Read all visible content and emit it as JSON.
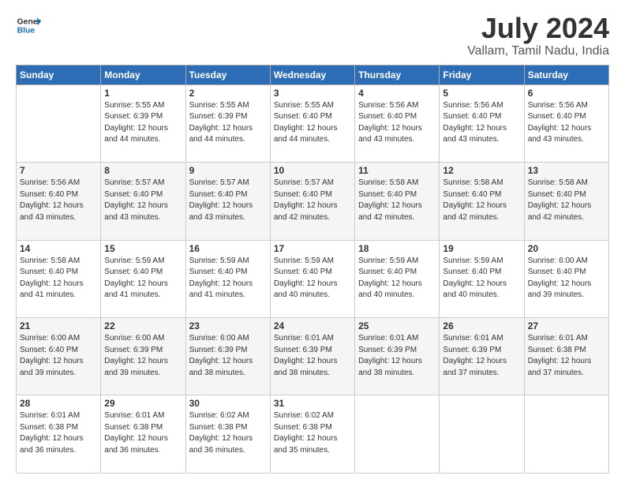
{
  "logo": {
    "line1": "General",
    "line2": "Blue"
  },
  "title": "July 2024",
  "subtitle": "Vallam, Tamil Nadu, India",
  "header_days": [
    "Sunday",
    "Monday",
    "Tuesday",
    "Wednesday",
    "Thursday",
    "Friday",
    "Saturday"
  ],
  "weeks": [
    [
      {
        "day": "",
        "sunrise": "",
        "sunset": "",
        "daylight": ""
      },
      {
        "day": "1",
        "sunrise": "Sunrise: 5:55 AM",
        "sunset": "Sunset: 6:39 PM",
        "daylight": "Daylight: 12 hours and 44 minutes."
      },
      {
        "day": "2",
        "sunrise": "Sunrise: 5:55 AM",
        "sunset": "Sunset: 6:39 PM",
        "daylight": "Daylight: 12 hours and 44 minutes."
      },
      {
        "day": "3",
        "sunrise": "Sunrise: 5:55 AM",
        "sunset": "Sunset: 6:40 PM",
        "daylight": "Daylight: 12 hours and 44 minutes."
      },
      {
        "day": "4",
        "sunrise": "Sunrise: 5:56 AM",
        "sunset": "Sunset: 6:40 PM",
        "daylight": "Daylight: 12 hours and 43 minutes."
      },
      {
        "day": "5",
        "sunrise": "Sunrise: 5:56 AM",
        "sunset": "Sunset: 6:40 PM",
        "daylight": "Daylight: 12 hours and 43 minutes."
      },
      {
        "day": "6",
        "sunrise": "Sunrise: 5:56 AM",
        "sunset": "Sunset: 6:40 PM",
        "daylight": "Daylight: 12 hours and 43 minutes."
      }
    ],
    [
      {
        "day": "7",
        "sunrise": "Sunrise: 5:56 AM",
        "sunset": "Sunset: 6:40 PM",
        "daylight": "Daylight: 12 hours and 43 minutes."
      },
      {
        "day": "8",
        "sunrise": "Sunrise: 5:57 AM",
        "sunset": "Sunset: 6:40 PM",
        "daylight": "Daylight: 12 hours and 43 minutes."
      },
      {
        "day": "9",
        "sunrise": "Sunrise: 5:57 AM",
        "sunset": "Sunset: 6:40 PM",
        "daylight": "Daylight: 12 hours and 43 minutes."
      },
      {
        "day": "10",
        "sunrise": "Sunrise: 5:57 AM",
        "sunset": "Sunset: 6:40 PM",
        "daylight": "Daylight: 12 hours and 42 minutes."
      },
      {
        "day": "11",
        "sunrise": "Sunrise: 5:58 AM",
        "sunset": "Sunset: 6:40 PM",
        "daylight": "Daylight: 12 hours and 42 minutes."
      },
      {
        "day": "12",
        "sunrise": "Sunrise: 5:58 AM",
        "sunset": "Sunset: 6:40 PM",
        "daylight": "Daylight: 12 hours and 42 minutes."
      },
      {
        "day": "13",
        "sunrise": "Sunrise: 5:58 AM",
        "sunset": "Sunset: 6:40 PM",
        "daylight": "Daylight: 12 hours and 42 minutes."
      }
    ],
    [
      {
        "day": "14",
        "sunrise": "Sunrise: 5:58 AM",
        "sunset": "Sunset: 6:40 PM",
        "daylight": "Daylight: 12 hours and 41 minutes."
      },
      {
        "day": "15",
        "sunrise": "Sunrise: 5:59 AM",
        "sunset": "Sunset: 6:40 PM",
        "daylight": "Daylight: 12 hours and 41 minutes."
      },
      {
        "day": "16",
        "sunrise": "Sunrise: 5:59 AM",
        "sunset": "Sunset: 6:40 PM",
        "daylight": "Daylight: 12 hours and 41 minutes."
      },
      {
        "day": "17",
        "sunrise": "Sunrise: 5:59 AM",
        "sunset": "Sunset: 6:40 PM",
        "daylight": "Daylight: 12 hours and 40 minutes."
      },
      {
        "day": "18",
        "sunrise": "Sunrise: 5:59 AM",
        "sunset": "Sunset: 6:40 PM",
        "daylight": "Daylight: 12 hours and 40 minutes."
      },
      {
        "day": "19",
        "sunrise": "Sunrise: 5:59 AM",
        "sunset": "Sunset: 6:40 PM",
        "daylight": "Daylight: 12 hours and 40 minutes."
      },
      {
        "day": "20",
        "sunrise": "Sunrise: 6:00 AM",
        "sunset": "Sunset: 6:40 PM",
        "daylight": "Daylight: 12 hours and 39 minutes."
      }
    ],
    [
      {
        "day": "21",
        "sunrise": "Sunrise: 6:00 AM",
        "sunset": "Sunset: 6:40 PM",
        "daylight": "Daylight: 12 hours and 39 minutes."
      },
      {
        "day": "22",
        "sunrise": "Sunrise: 6:00 AM",
        "sunset": "Sunset: 6:39 PM",
        "daylight": "Daylight: 12 hours and 39 minutes."
      },
      {
        "day": "23",
        "sunrise": "Sunrise: 6:00 AM",
        "sunset": "Sunset: 6:39 PM",
        "daylight": "Daylight: 12 hours and 38 minutes."
      },
      {
        "day": "24",
        "sunrise": "Sunrise: 6:01 AM",
        "sunset": "Sunset: 6:39 PM",
        "daylight": "Daylight: 12 hours and 38 minutes."
      },
      {
        "day": "25",
        "sunrise": "Sunrise: 6:01 AM",
        "sunset": "Sunset: 6:39 PM",
        "daylight": "Daylight: 12 hours and 38 minutes."
      },
      {
        "day": "26",
        "sunrise": "Sunrise: 6:01 AM",
        "sunset": "Sunset: 6:39 PM",
        "daylight": "Daylight: 12 hours and 37 minutes."
      },
      {
        "day": "27",
        "sunrise": "Sunrise: 6:01 AM",
        "sunset": "Sunset: 6:38 PM",
        "daylight": "Daylight: 12 hours and 37 minutes."
      }
    ],
    [
      {
        "day": "28",
        "sunrise": "Sunrise: 6:01 AM",
        "sunset": "Sunset: 6:38 PM",
        "daylight": "Daylight: 12 hours and 36 minutes."
      },
      {
        "day": "29",
        "sunrise": "Sunrise: 6:01 AM",
        "sunset": "Sunset: 6:38 PM",
        "daylight": "Daylight: 12 hours and 36 minutes."
      },
      {
        "day": "30",
        "sunrise": "Sunrise: 6:02 AM",
        "sunset": "Sunset: 6:38 PM",
        "daylight": "Daylight: 12 hours and 36 minutes."
      },
      {
        "day": "31",
        "sunrise": "Sunrise: 6:02 AM",
        "sunset": "Sunset: 6:38 PM",
        "daylight": "Daylight: 12 hours and 35 minutes."
      },
      {
        "day": "",
        "sunrise": "",
        "sunset": "",
        "daylight": ""
      },
      {
        "day": "",
        "sunrise": "",
        "sunset": "",
        "daylight": ""
      },
      {
        "day": "",
        "sunrise": "",
        "sunset": "",
        "daylight": ""
      }
    ]
  ]
}
